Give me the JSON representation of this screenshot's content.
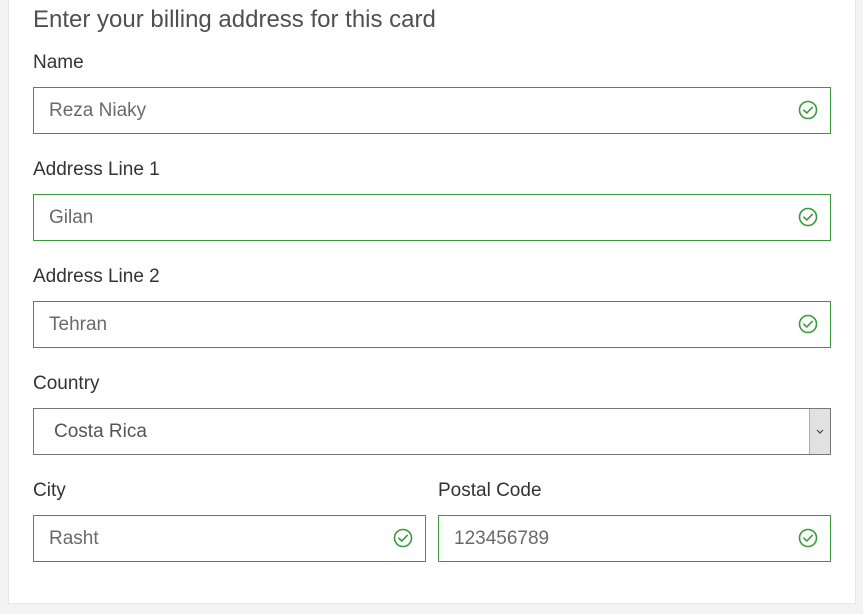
{
  "form": {
    "heading": "Enter your billing address for this card",
    "name": {
      "label": "Name",
      "value": "Reza Niaky",
      "valid": true
    },
    "address1": {
      "label": "Address Line 1",
      "value": "Gilan",
      "valid": true
    },
    "address2": {
      "label": "Address Line 2",
      "value": "Tehran",
      "valid": true
    },
    "country": {
      "label": "Country",
      "selected": "Costa Rica"
    },
    "city": {
      "label": "City",
      "value": "Rasht",
      "valid": true
    },
    "postal": {
      "label": "Postal Code",
      "value": "123456789",
      "valid": true
    }
  },
  "colors": {
    "valid_border": "#3a9a3a",
    "check_icon": "#3a9a3a"
  },
  "icons": {
    "valid": "check-circle-icon",
    "dropdown": "chevron-down-icon"
  }
}
